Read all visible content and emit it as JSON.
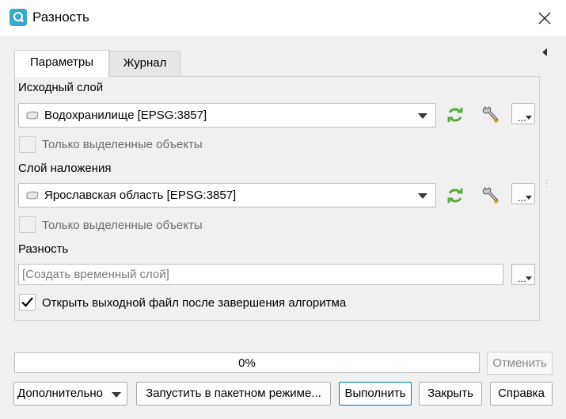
{
  "window": {
    "title": "Разность"
  },
  "tabs": [
    {
      "label": "Параметры",
      "active": true
    },
    {
      "label": "Журнал",
      "active": false
    }
  ],
  "params": {
    "input_layer": {
      "label": "Исходный слой",
      "value": "Водохранилище [EPSG:3857]",
      "selected_only_label": "Только выделенные объекты"
    },
    "overlay_layer": {
      "label": "Слой наложения",
      "value": "Ярославская область [EPSG:3857]",
      "selected_only_label": "Только выделенные объекты"
    },
    "output": {
      "label": "Разность",
      "placeholder": "[Создать временный слой]",
      "open_after_label": "Открыть выходной файл после завершения алгоритма",
      "open_after_checked": true
    },
    "dots_label": "..."
  },
  "progress": {
    "text": "0%",
    "value": 0
  },
  "buttons": {
    "cancel": "Отменить",
    "advanced": "Дополнительно",
    "batch": "Запустить в пакетном режиме...",
    "run": "Выполнить",
    "close": "Закрыть",
    "help": "Справка"
  },
  "colors": {
    "accent": "#0078d7",
    "refresh_icon": "#5aab3c",
    "app_icon": "#3aa8c9"
  }
}
